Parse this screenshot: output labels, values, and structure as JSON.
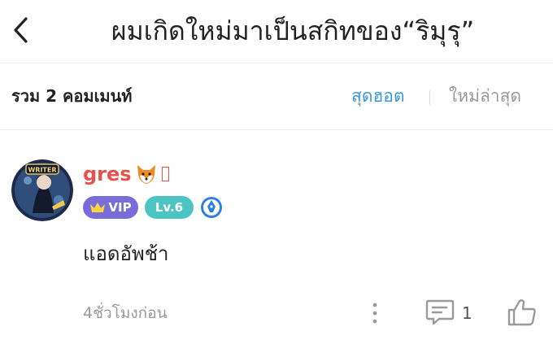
{
  "header": {
    "title": "ผมเกิดใหม่มาเป็นสกิทของ“ริมุรุ”",
    "back_icon": "chevron-left-icon"
  },
  "sort_bar": {
    "total_label": "รวม 2 คอมเมนท์",
    "hot_label": "สุดฮอต",
    "newest_label": "ใหม่ล่าสุด",
    "active_color": "#3a98dc",
    "inactive_color": "#999999"
  },
  "comment": {
    "username": "gres",
    "username_color": "#e8504a",
    "avatar_badge_text": "WRITER",
    "vip_label": "VIP",
    "level_label": "Lv.6",
    "text": "แอดอัพช้า",
    "time": "4ชั่วโมงก่อน",
    "reply_count": "1",
    "icons": {
      "emoji": "fox-face-icon",
      "more": "more-vertical-icon",
      "reply": "comment-icon",
      "like": "thumbs-up-icon",
      "badge": "pen-nib-badge-icon",
      "vip": "crown-icon"
    }
  }
}
